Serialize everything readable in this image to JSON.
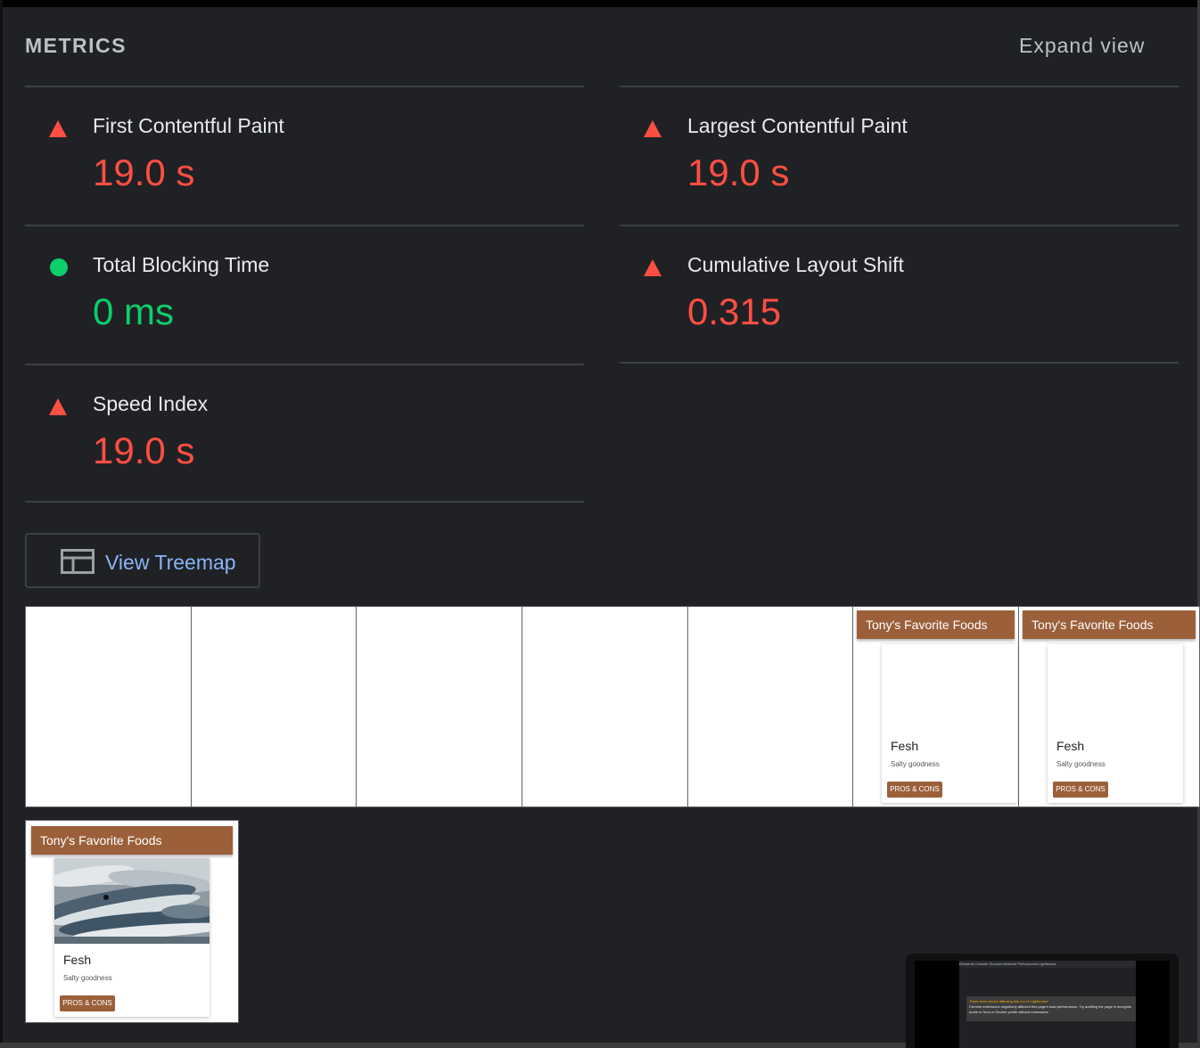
{
  "header": {
    "title": "METRICS",
    "expand_label": "Expand view"
  },
  "metrics": [
    {
      "label": "First Contentful Paint",
      "value": "19.0 s",
      "status": "fail"
    },
    {
      "label": "Largest Contentful Paint",
      "value": "19.0 s",
      "status": "fail"
    },
    {
      "label": "Total Blocking Time",
      "value": "0 ms",
      "status": "pass"
    },
    {
      "label": "Cumulative Layout Shift",
      "value": "0.315",
      "status": "fail"
    },
    {
      "label": "Speed Index",
      "value": "19.0 s",
      "status": "fail"
    }
  ],
  "treemap": {
    "label": "View Treemap"
  },
  "filmstrip": {
    "frames": [
      {
        "blank": true
      },
      {
        "blank": true
      },
      {
        "blank": true
      },
      {
        "blank": true
      },
      {
        "blank": true
      },
      {
        "header": "Tony's Favorite Foods",
        "card_title": "Fesh",
        "card_subtitle": "Salty goodness",
        "button": "PROS & CONS"
      },
      {
        "header": "Tony's Favorite Foods",
        "card_title": "Fesh",
        "card_subtitle": "Salty goodness",
        "button": "PROS & CONS"
      }
    ],
    "final_frame": {
      "header": "Tony's Favorite Foods",
      "card_title": "Fesh",
      "card_subtitle": "Salty goodness",
      "button": "PROS & CONS"
    }
  },
  "screenshot_thumb": {
    "tabs": "Elements  Console  Sources  Network  Performance  Lighthouse",
    "warning_title": "There were issues affecting this run of Lighthouse:",
    "warning_body": "Chrome extensions negatively affected this page's load performance. Try auditing the page in incognito mode or from a Chrome profile without extensions."
  },
  "colors": {
    "background": "#202124",
    "fail": "#ff4e42",
    "pass": "#0cce6b",
    "link": "#8ab4f8",
    "app_header": "#9b603a"
  },
  "icons": {
    "fail": "triangle-warning-icon",
    "pass": "circle-pass-icon",
    "treemap": "treemap-icon"
  }
}
